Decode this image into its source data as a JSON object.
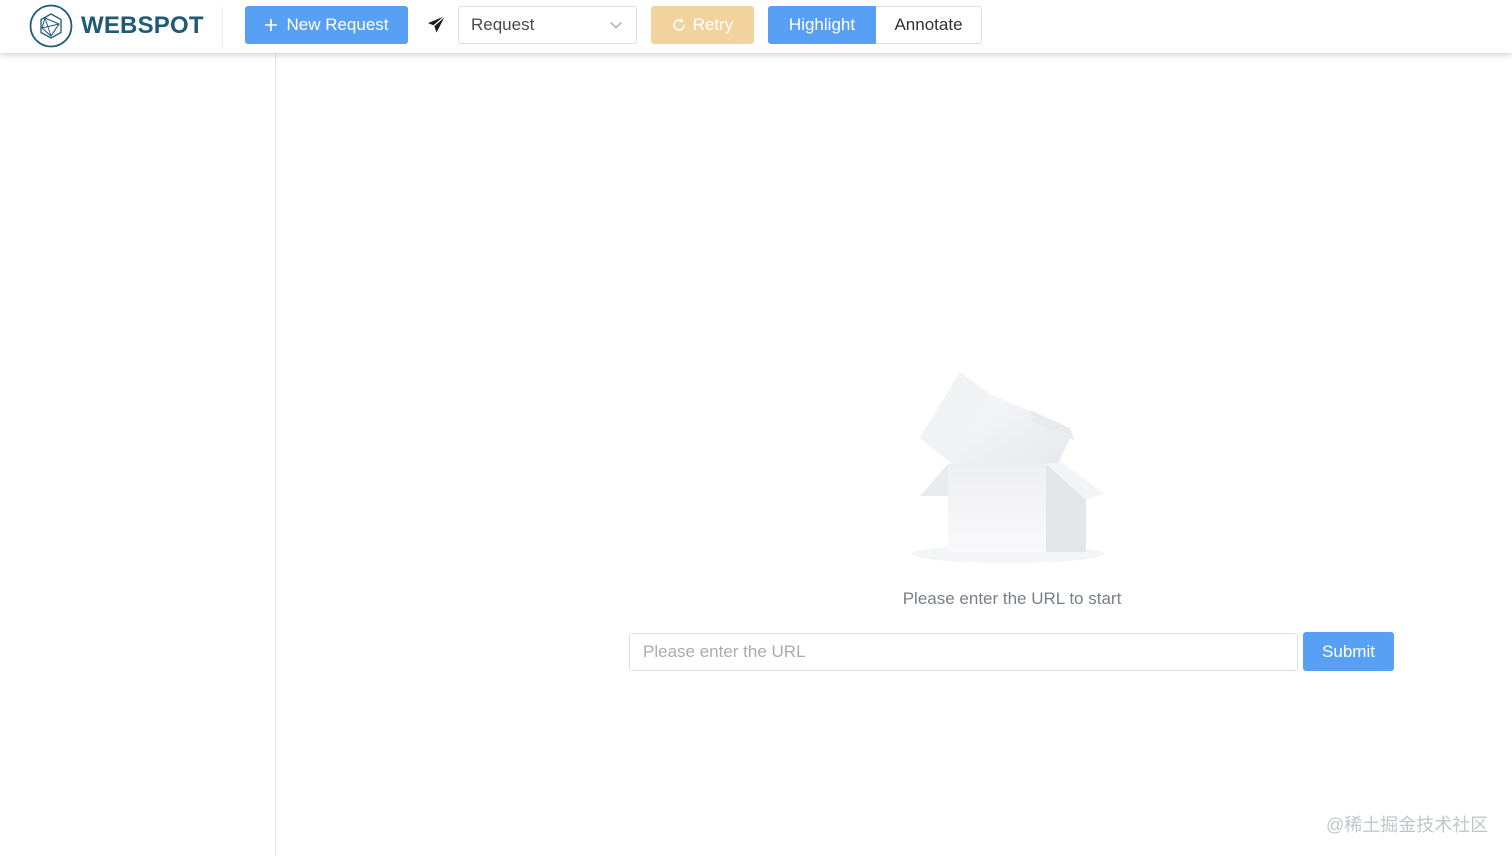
{
  "header": {
    "brand": "WEBSPOT",
    "new_request_label": "New Request",
    "request_type_value": "Request",
    "retry_label": "Retry",
    "mode_group": [
      {
        "label": "Highlight",
        "active": true
      },
      {
        "label": "Annotate",
        "active": false
      }
    ]
  },
  "main": {
    "empty_message": "Please enter the URL to start",
    "url_placeholder": "Please enter the URL",
    "submit_label": "Submit"
  },
  "watermark": "@稀土掘金技术社区",
  "colors": {
    "primary": "#58a0f5",
    "retry_disabled": "#f2d39e",
    "brand_text": "#1f5a77"
  },
  "icons": {
    "logo": "webspot-logo-icon",
    "new_request": "plus-icon",
    "send": "paper-plane-icon",
    "select": "chevron-down-icon",
    "retry": "refresh-icon",
    "empty": "empty-box-icon"
  }
}
